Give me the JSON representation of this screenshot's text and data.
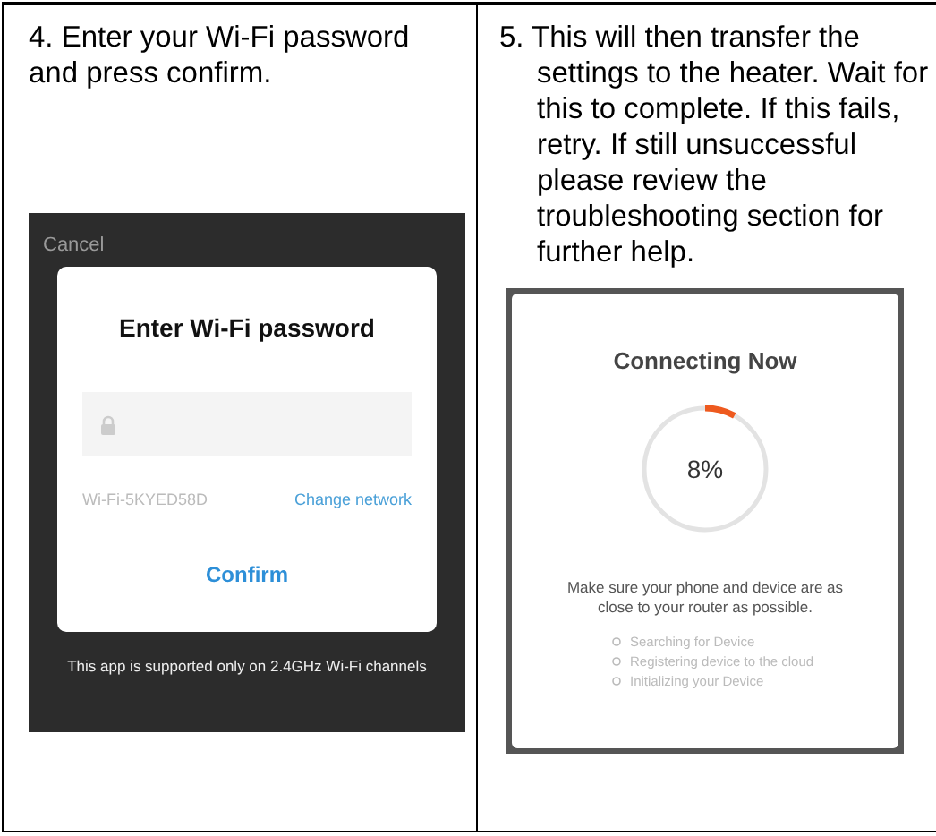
{
  "steps": [
    {
      "kind": "password",
      "instruction": "4. Enter your Wi-Fi password and press confirm.",
      "screen": {
        "cancel": "Cancel",
        "title": "Enter Wi-Fi password",
        "network": "Wi-Fi-5KYED58D",
        "change_link": "Change network",
        "confirm": "Confirm",
        "note": "This app is supported only on 2.4GHz Wi-Fi channels"
      }
    },
    {
      "kind": "progress",
      "instruction": "5. This will then transfer the settings to the heater. Wait for this to complete. If this fails, retry. If still unsuccessful please review the troubleshooting section for further help.",
      "screen": {
        "title": "Connecting Now",
        "level": 0.08,
        "reading": "8%",
        "hint": "Make sure your phone and device are as close to your router as possible.",
        "tasks": [
          "Searching for Device",
          "Registering device to the cloud",
          "Initializing your Device"
        ]
      }
    }
  ]
}
